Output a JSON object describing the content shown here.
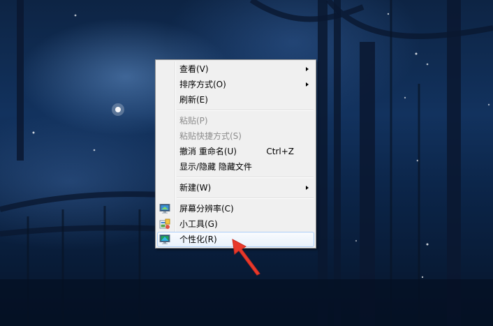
{
  "menu": {
    "items": [
      {
        "label": "查看(V)",
        "submenu": true
      },
      {
        "label": "排序方式(O)",
        "submenu": true
      },
      {
        "label": "刷新(E)"
      },
      {
        "label": "粘贴(P)",
        "disabled": true
      },
      {
        "label": "粘贴快捷方式(S)",
        "disabled": true
      },
      {
        "label": "撤消 重命名(U)",
        "shortcut": "Ctrl+Z"
      },
      {
        "label": "显示/隐藏 隐藏文件"
      },
      {
        "label": "新建(W)",
        "submenu": true
      },
      {
        "label": "屏幕分辨率(C)",
        "icon": "screen-resolution-icon"
      },
      {
        "label": "小工具(G)",
        "icon": "gadgets-icon"
      },
      {
        "label": "个性化(R)",
        "icon": "personalize-icon",
        "highlighted": true
      }
    ]
  },
  "annotation": {
    "color": "#e8392b",
    "icon": "red-arrow-pointer"
  }
}
